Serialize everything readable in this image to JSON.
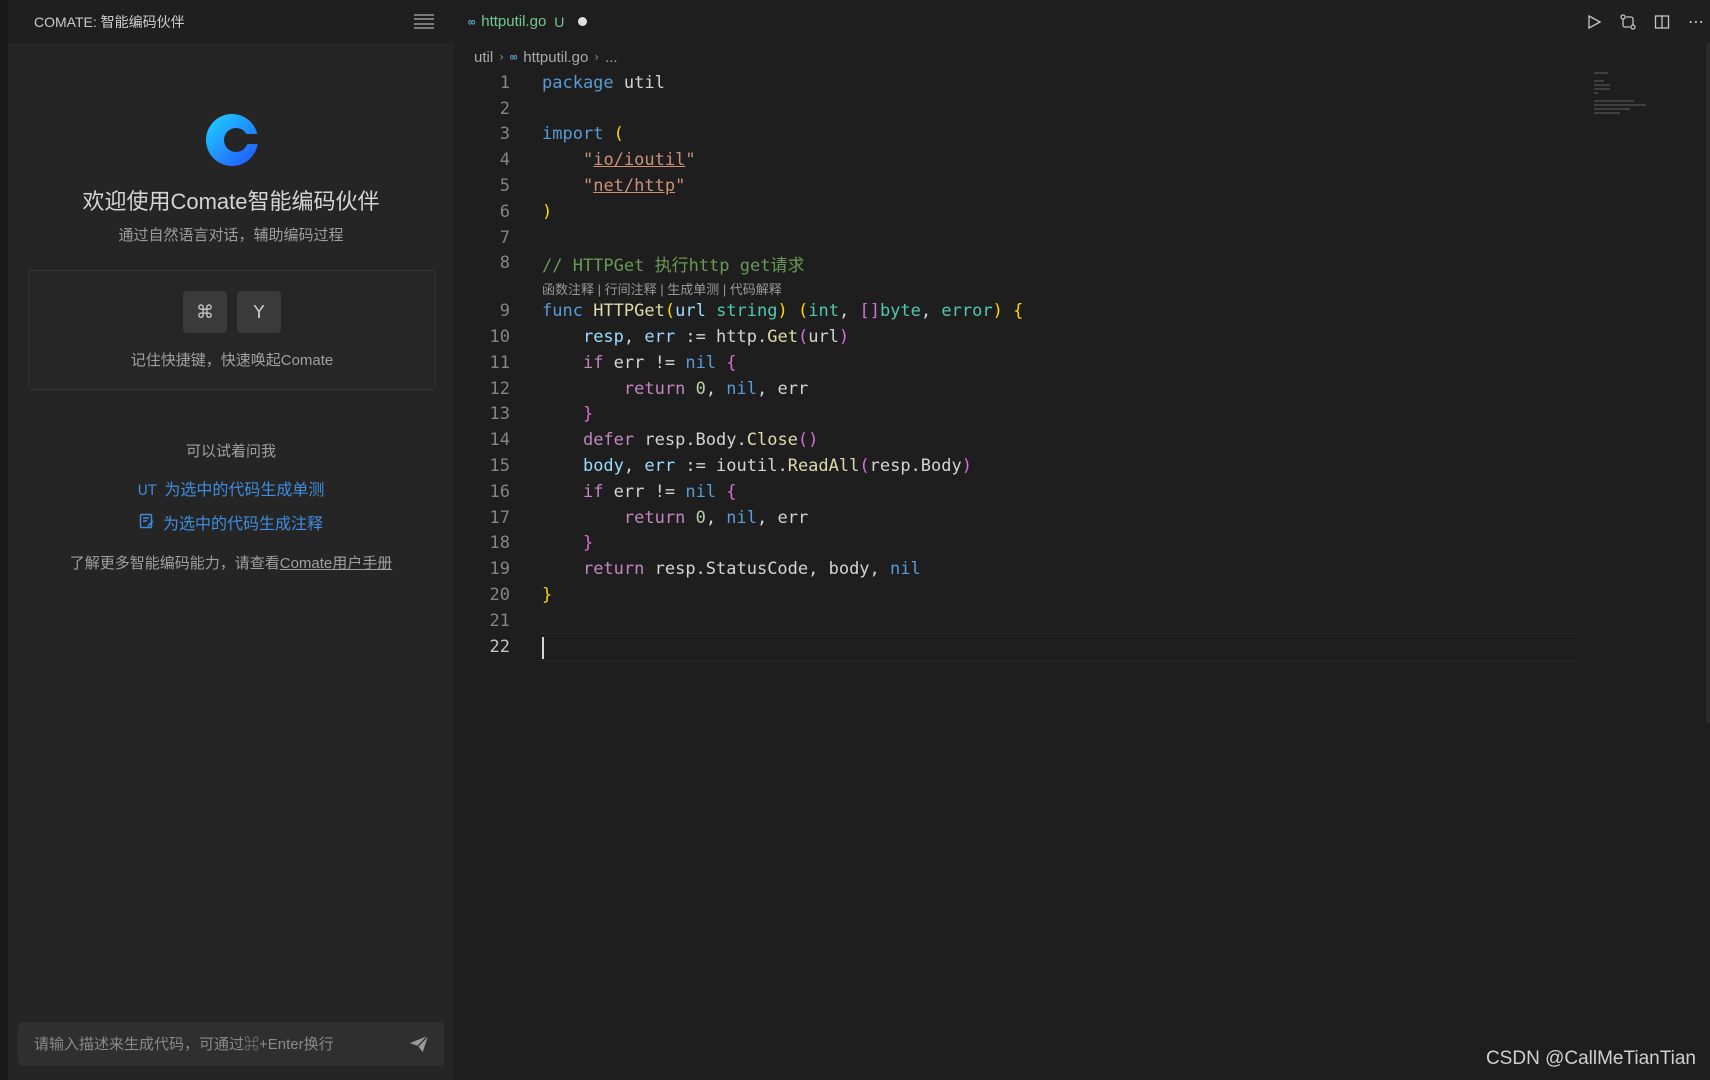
{
  "sidebar": {
    "title": "COMATE: 智能编码伙伴",
    "welcome_title": "欢迎使用Comate智能编码伙伴",
    "welcome_subtitle": "通过自然语言对话，辅助编码过程",
    "shortcut_keys": [
      "⌘",
      "Y"
    ],
    "shortcut_hint": "记住快捷键，快速唤起Comate",
    "try_title": "可以试着问我",
    "suggestions": [
      {
        "icon": "UT",
        "label": "为选中的代码生成单测"
      },
      {
        "icon": "comment-icon",
        "label": "为选中的代码生成注释"
      }
    ],
    "learn_more_prefix": "了解更多智能编码能力，请查看",
    "learn_more_link": "Comate用户手册",
    "chat_placeholder": "请输入描述来生成代码，可通过⌘+Enter换行"
  },
  "editor": {
    "tab": {
      "name": "httputil.go",
      "status": "U"
    },
    "breadcrumb": [
      "util",
      "httputil.go",
      "..."
    ],
    "codelens": "函数注释 | 行间注释 | 生成单测 | 代码解释",
    "line_numbers": [
      "1",
      "2",
      "3",
      "4",
      "5",
      "6",
      "7",
      "8",
      "9",
      "10",
      "11",
      "12",
      "13",
      "14",
      "15",
      "16",
      "17",
      "18",
      "19",
      "20",
      "21",
      "22"
    ],
    "current_line": "22"
  },
  "colors": {
    "accent": "#3e8ddf",
    "modified": "#73c991",
    "keyword": "#569cd6",
    "string": "#ce9178",
    "comment": "#6a9955"
  },
  "watermark": "CSDN @CallMeTianTian"
}
